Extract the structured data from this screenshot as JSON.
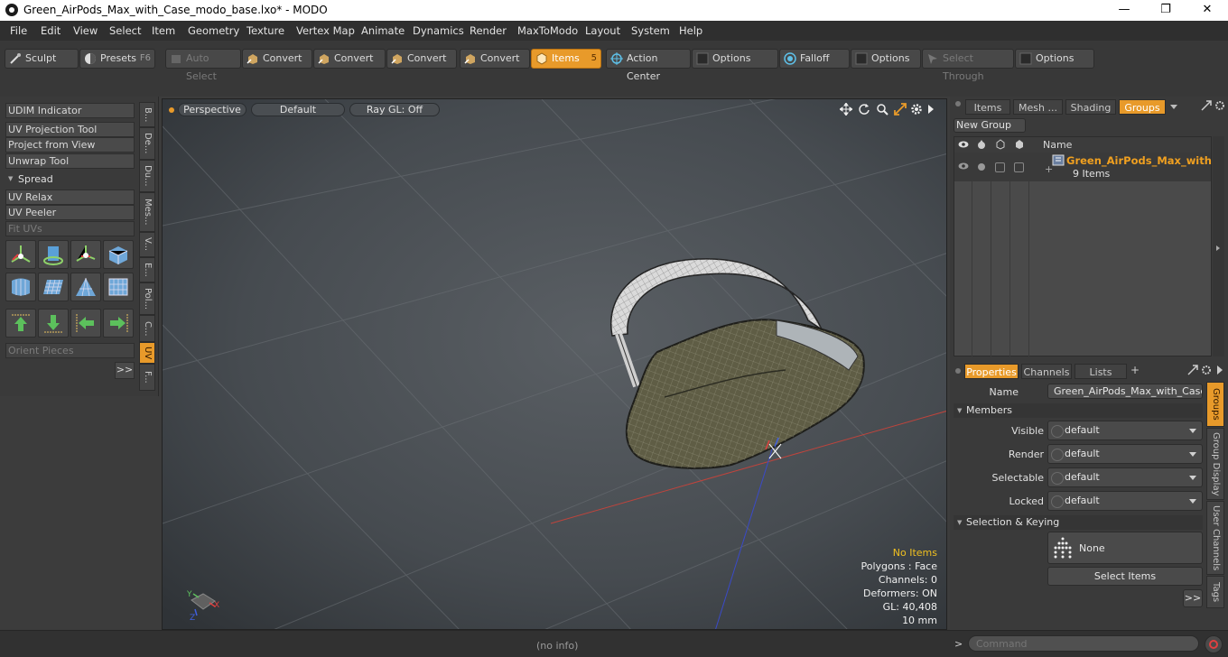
{
  "window": {
    "title": "Green_AirPods_Max_with_Case_modo_base.lxo* - MODO",
    "minimize": "—",
    "maximize": "❐",
    "close": "✕"
  },
  "menu": [
    "File",
    "Edit",
    "View",
    "Select",
    "Item",
    "Geometry",
    "Texture",
    "Vertex Map",
    "Animate",
    "Dynamics",
    "Render",
    "MaxToModo",
    "Layout",
    "System",
    "Help"
  ],
  "toolbar": {
    "sculpt": "Sculpt",
    "presets": "Presets",
    "presets_key": "F6",
    "auto_select": "Auto Select",
    "convert1": "Convert",
    "convert2": "Convert",
    "convert3": "Convert",
    "convert4": "Convert",
    "items": "Items",
    "items_key": "5",
    "action_center": "Action Center",
    "options1": "Options",
    "falloff": "Falloff",
    "options2": "Options",
    "select_through": "Select Through",
    "options3": "Options"
  },
  "left_panel": {
    "udim": "UDIM Indicator",
    "uv_projection": "UV Projection Tool",
    "project_view": "Project from View",
    "unwrap": "Unwrap Tool",
    "spread": "Spread",
    "uv_relax": "UV Relax",
    "uv_peeler": "UV Peeler",
    "fit_uvs": "Fit UVs",
    "orient": "Orient Pieces",
    "more": ">>",
    "tabs": [
      "B...",
      "De...",
      "Du...",
      "Mes...",
      "V...",
      "E...",
      "Pol...",
      "C...",
      "UV",
      "F..."
    ]
  },
  "viewport": {
    "perspective": "Perspective",
    "default": "Default",
    "raygl": "Ray GL: Off",
    "hud_no_items": "No Items",
    "hud_polygons": "Polygons : Face",
    "hud_channels": "Channels: 0",
    "hud_deformers": "Deformers: ON",
    "hud_gl": "GL: 40,408",
    "hud_scale": "10 mm",
    "axis_x": "X",
    "axis_y": "Y",
    "axis_z": "Z"
  },
  "right_panel": {
    "tabs": [
      "Items",
      "Mesh ...",
      "Shading",
      "Groups"
    ],
    "new_group": "New Group",
    "col_name": "Name",
    "group_name": "Green_AirPods_Max_with...",
    "group_count": "9 Items",
    "prop_tabs": [
      "Properties",
      "Channels",
      "Lists"
    ],
    "add_tab": "+",
    "name_label": "Name",
    "name_value": "Green_AirPods_Max_with_Case (",
    "members": "Members",
    "visible": "Visible",
    "render": "Render",
    "selectable": "Selectable",
    "locked": "Locked",
    "default_value": "default",
    "selection_keying": "Selection & Keying",
    "none": "None",
    "select_items": "Select Items",
    "more": ">>",
    "side_tabs": [
      "Groups",
      "Group Display",
      "User Channels",
      "Tags"
    ]
  },
  "status": {
    "info": "(no info)",
    "command_prompt": ">",
    "command_placeholder": "Command"
  },
  "colors": {
    "accent": "#e89a2a",
    "hud_warning": "#f0c020"
  }
}
